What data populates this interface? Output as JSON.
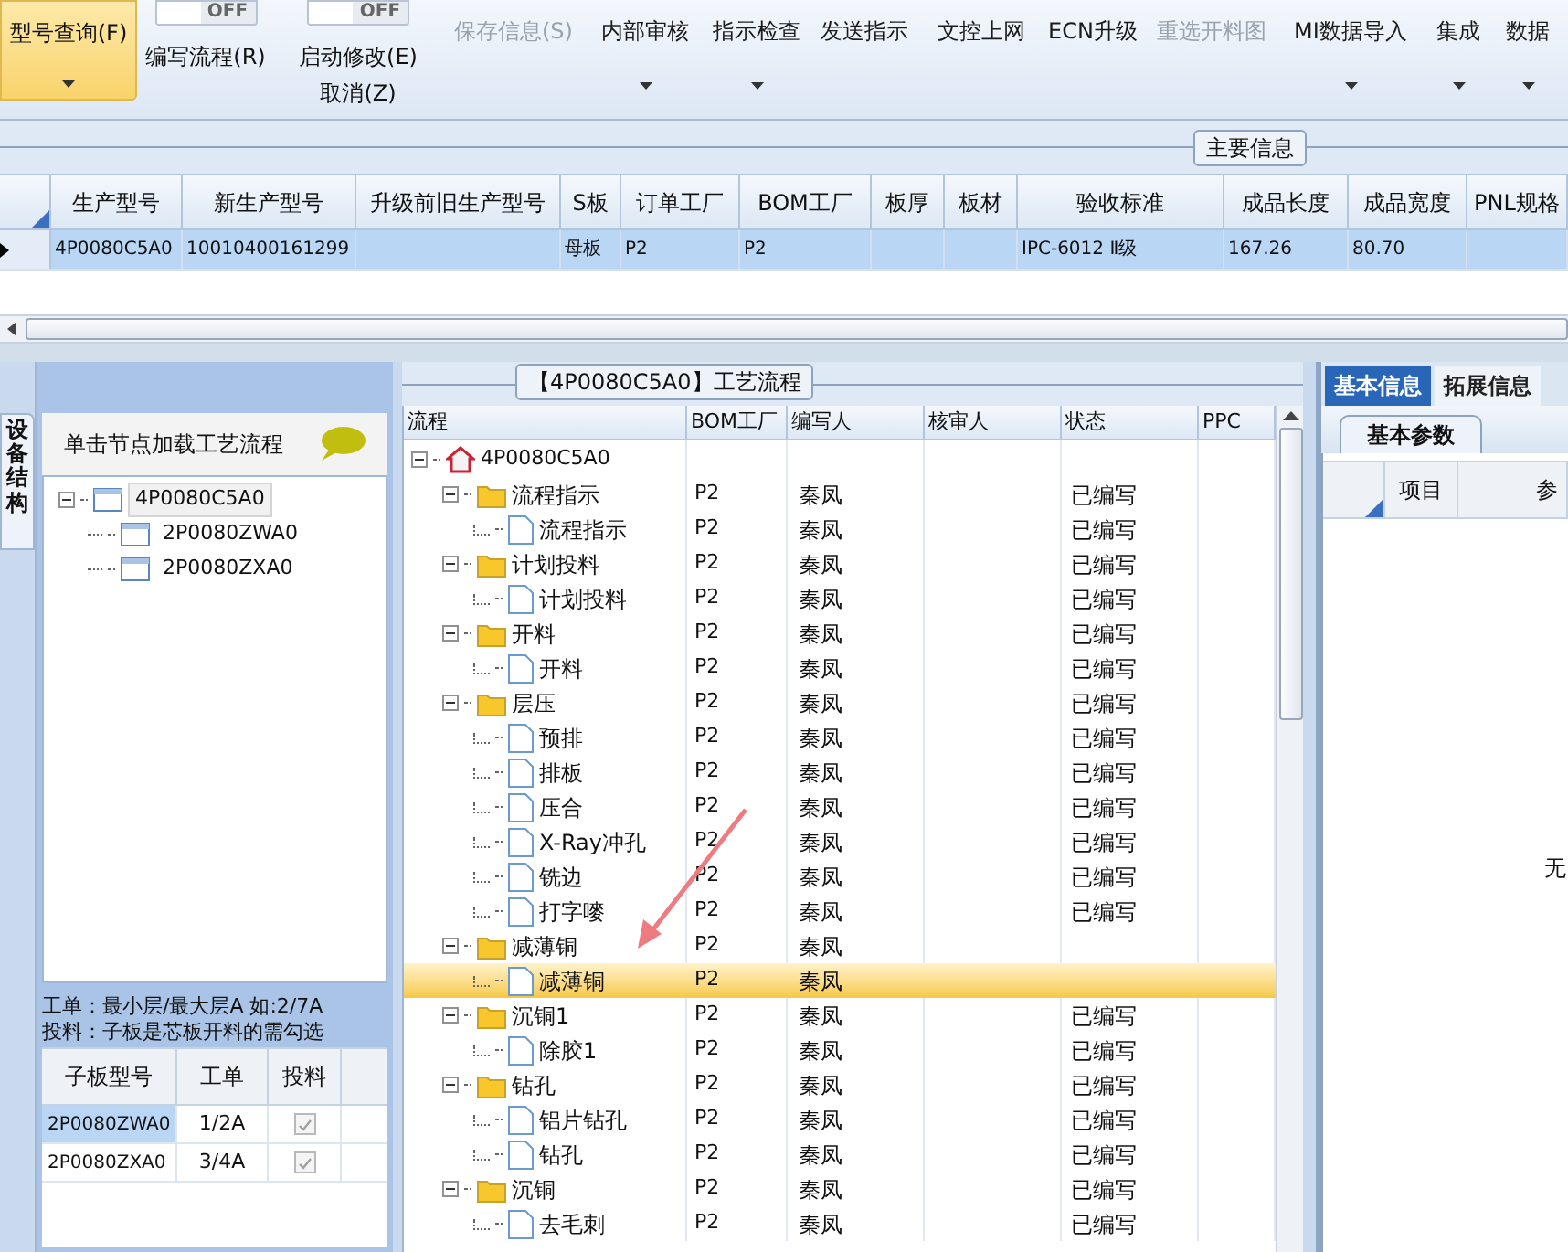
{
  "ribbon": {
    "items": [
      {
        "kind": "highlight",
        "label": "型号查询(F)",
        "has_menu": true
      },
      {
        "kind": "toggle",
        "switch_text": "OFF",
        "on": false,
        "labels": [
          "编写流程(R)"
        ]
      },
      {
        "kind": "toggle",
        "switch_text": "OFF",
        "on": false,
        "labels": [
          "启动修改(E)",
          "取消(Z)"
        ]
      },
      {
        "kind": "button",
        "label": "保存信息(S)",
        "disabled": true,
        "has_menu": false
      },
      {
        "kind": "button",
        "label": "内部审核",
        "disabled": false,
        "has_menu": true
      },
      {
        "kind": "button",
        "label": "指示检查",
        "disabled": false,
        "has_menu": true
      },
      {
        "kind": "button",
        "label": "发送指示",
        "disabled": false,
        "has_menu": false
      },
      {
        "kind": "button",
        "label": "文控上网",
        "disabled": false,
        "has_menu": false
      },
      {
        "kind": "button",
        "label": "ECN升级",
        "disabled": false,
        "has_menu": false
      },
      {
        "kind": "button",
        "label": "重选开料图",
        "disabled": true,
        "has_menu": false
      },
      {
        "kind": "button",
        "label": "MI数据导入",
        "disabled": false,
        "has_menu": true
      },
      {
        "kind": "button",
        "label": "集成",
        "disabled": false,
        "has_menu": true
      },
      {
        "kind": "button",
        "label": "数据",
        "disabled": false,
        "has_menu": true
      }
    ]
  },
  "main_info": {
    "title": "主要信息",
    "columns": [
      "生产型号",
      "新生产型号",
      "升级前旧生产型号",
      "S板",
      "订单工厂",
      "BOM工厂",
      "板厚",
      "板材",
      "验收标准",
      "成品长度",
      "成品宽度",
      "PNL规格"
    ],
    "rows": [
      {
        "selected": true,
        "cells": [
          "4P0080C5A0",
          "10010400161299",
          "",
          "母板",
          "P2",
          "P2",
          "",
          "",
          "IPC-6012 Ⅱ级",
          "167.26",
          "80.70",
          ""
        ]
      }
    ]
  },
  "side_tab": {
    "label": "设备结构",
    "selected": true
  },
  "structure": {
    "hint": "单击节点加载工艺流程",
    "tree": [
      {
        "label": "4P0080C5A0",
        "selected": true,
        "expanded": true,
        "children": [
          {
            "label": "2P0080ZWA0",
            "selected": false
          },
          {
            "label": "2P0080ZXA0",
            "selected": false
          }
        ]
      }
    ],
    "notes": [
      "工单：最小层/最大层A 如:2/7A",
      "投料：子板是芯板开料的需勾选"
    ],
    "table": {
      "columns": [
        "子板型号",
        "工单",
        "投料"
      ],
      "rows": [
        {
          "board": "2P0080ZWA0",
          "order": "1/2A",
          "checked": true,
          "selected": true
        },
        {
          "board": "2P0080ZXA0",
          "order": "3/4A",
          "checked": true,
          "selected": false
        }
      ]
    }
  },
  "process": {
    "title": "【4P0080C5A0】工艺流程",
    "columns": [
      "流程",
      "BOM工厂",
      "编写人",
      "核审人",
      "状态",
      "PPC"
    ],
    "tree": [
      {
        "kind": "root",
        "label": "4P0080C5A0",
        "selected": false,
        "expanded": true,
        "children": [
          {
            "kind": "folder",
            "label": "流程指示",
            "bom": "P2",
            "writer": "秦凤",
            "status": "已编写",
            "selected": false,
            "expanded": true,
            "children": [
              {
                "kind": "step",
                "label": "流程指示",
                "bom": "P2",
                "writer": "秦凤",
                "status": "已编写",
                "selected": false
              }
            ]
          },
          {
            "kind": "folder",
            "label": "计划投料",
            "bom": "P2",
            "writer": "秦凤",
            "status": "已编写",
            "selected": false,
            "expanded": true,
            "children": [
              {
                "kind": "step",
                "label": "计划投料",
                "bom": "P2",
                "writer": "秦凤",
                "status": "已编写",
                "selected": false
              }
            ]
          },
          {
            "kind": "folder",
            "label": "开料",
            "bom": "P2",
            "writer": "秦凤",
            "status": "已编写",
            "selected": false,
            "expanded": true,
            "children": [
              {
                "kind": "step",
                "label": "开料",
                "bom": "P2",
                "writer": "秦凤",
                "status": "已编写",
                "selected": false
              }
            ]
          },
          {
            "kind": "folder",
            "label": "层压",
            "bom": "P2",
            "writer": "秦凤",
            "status": "已编写",
            "selected": false,
            "expanded": true,
            "children": [
              {
                "kind": "step",
                "label": "预排",
                "bom": "P2",
                "writer": "秦凤",
                "status": "已编写",
                "selected": false
              },
              {
                "kind": "step",
                "label": "排板",
                "bom": "P2",
                "writer": "秦凤",
                "status": "已编写",
                "selected": false
              },
              {
                "kind": "step",
                "label": "压合",
                "bom": "P2",
                "writer": "秦凤",
                "status": "已编写",
                "selected": false
              },
              {
                "kind": "step",
                "label": "X-Ray冲孔",
                "bom": "P2",
                "writer": "秦凤",
                "status": "已编写",
                "selected": false
              },
              {
                "kind": "step",
                "label": "铣边",
                "bom": "P2",
                "writer": "秦凤",
                "status": "已编写",
                "selected": false
              },
              {
                "kind": "step",
                "label": "打字嘜",
                "bom": "P2",
                "writer": "秦凤",
                "status": "已编写",
                "selected": false
              }
            ]
          },
          {
            "kind": "folder",
            "label": "减薄铜",
            "bom": "P2",
            "writer": "秦凤",
            "selected": false,
            "expanded": true,
            "children": [
              {
                "kind": "step",
                "label": "减薄铜",
                "bom": "P2",
                "writer": "秦凤",
                "selected": true
              }
            ]
          },
          {
            "kind": "folder",
            "label": "沉铜1",
            "bom": "P2",
            "writer": "秦凤",
            "status": "已编写",
            "selected": false,
            "expanded": true,
            "children": [
              {
                "kind": "step",
                "label": "除胶1",
                "bom": "P2",
                "writer": "秦凤",
                "status": "已编写",
                "selected": false
              }
            ]
          },
          {
            "kind": "folder",
            "label": "钻孔",
            "bom": "P2",
            "writer": "秦凤",
            "status": "已编写",
            "selected": false,
            "expanded": true,
            "children": [
              {
                "kind": "step",
                "label": "铝片钻孔",
                "bom": "P2",
                "writer": "秦凤",
                "status": "已编写",
                "selected": false
              },
              {
                "kind": "step",
                "label": "钻孔",
                "bom": "P2",
                "writer": "秦凤",
                "status": "已编写",
                "selected": false
              }
            ]
          },
          {
            "kind": "folder",
            "label": "沉铜",
            "bom": "P2",
            "writer": "秦凤",
            "status": "已编写",
            "selected": false,
            "expanded": true,
            "children": [
              {
                "kind": "step",
                "label": "去毛刺",
                "bom": "P2",
                "writer": "秦凤",
                "status": "已编写",
                "selected": false
              }
            ]
          }
        ]
      }
    ]
  },
  "info_panel": {
    "tabs": [
      {
        "label": "基本信息",
        "selected": true
      },
      {
        "label": "拓展信息",
        "selected": false
      }
    ],
    "subtabs": [
      {
        "label": "基本参数",
        "selected": true
      }
    ],
    "columns": [
      "项目",
      "参"
    ],
    "empty_text": "无"
  }
}
